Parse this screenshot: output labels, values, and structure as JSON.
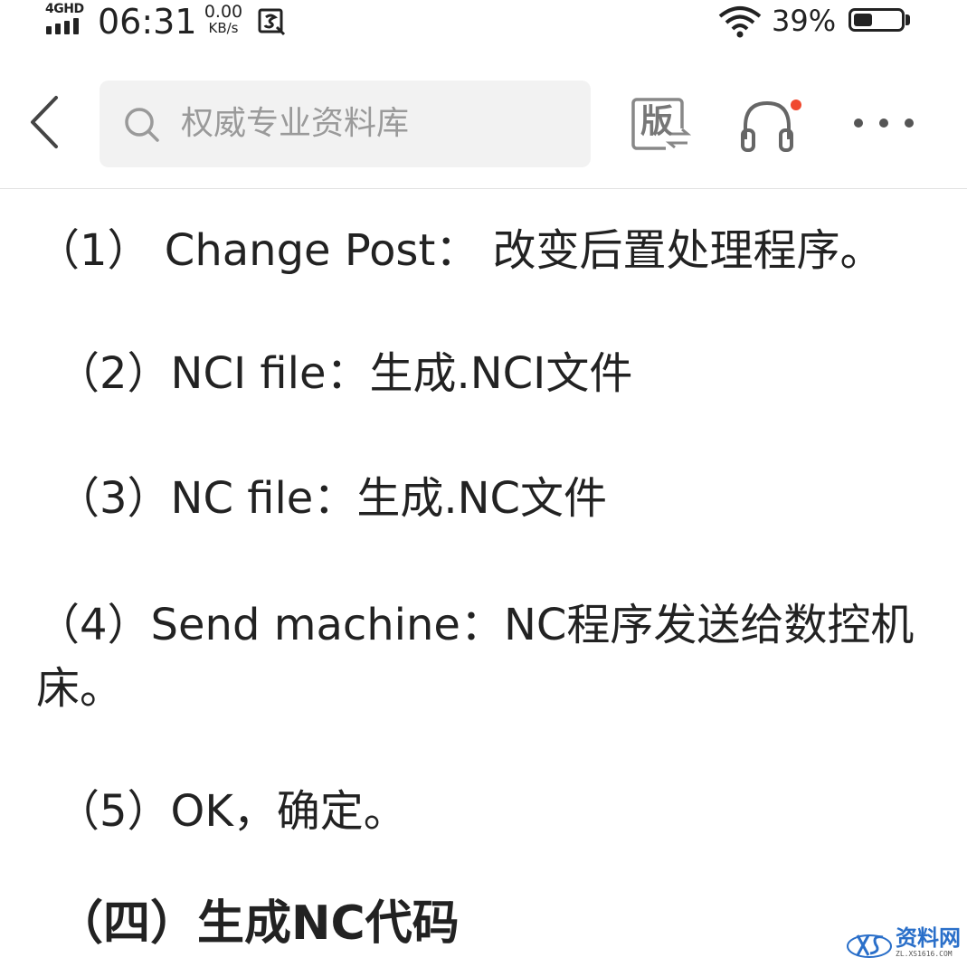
{
  "status_bar": {
    "network": "4GHD",
    "time": "06:31",
    "speed_value": "0.00",
    "speed_unit": "KB/s",
    "battery_percent": "39%",
    "battery_level": 0.39
  },
  "nav": {
    "search_placeholder": "权威专业资料库",
    "version_label": "版",
    "audio_badge_color": "#f0492f"
  },
  "article": {
    "paragraphs": [
      "（1） Change Post： 改变后置处理程序。",
      "（2）NCI file：生成.NCI文件",
      "（3）NC file：生成.NC文件",
      "（4）Send machine：NC程序发送给数控机床。",
      "（5）OK，确定。"
    ],
    "heading": "（四）生成NC代码"
  },
  "watermark": {
    "text": "资料网",
    "url": "ZL.XS1616.COM"
  }
}
